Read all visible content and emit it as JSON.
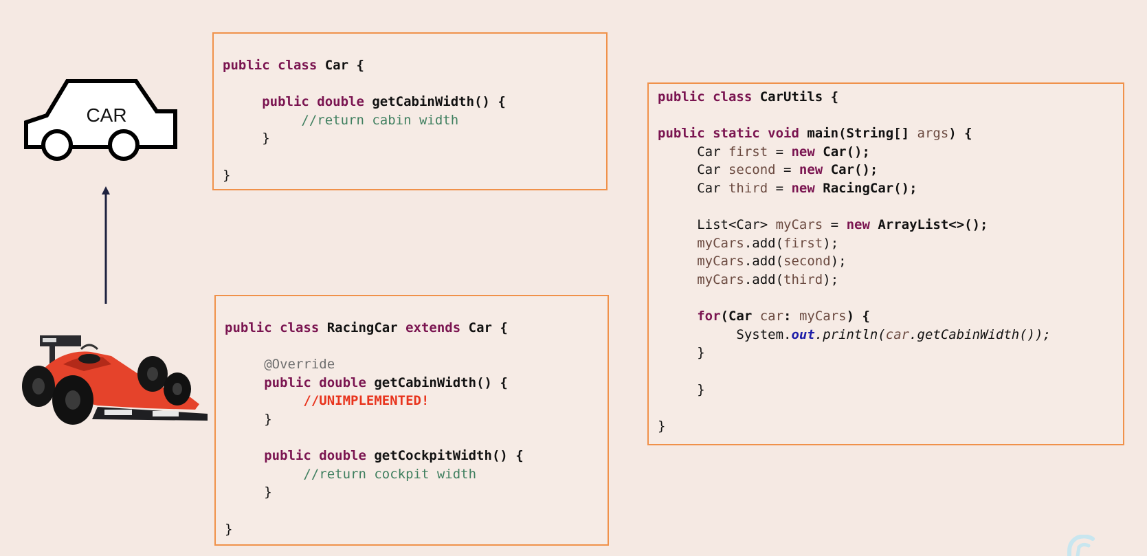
{
  "car_icon": {
    "label": "CAR"
  },
  "car_class": {
    "lines": [
      [
        {
          "t": "public class ",
          "s": "kw"
        },
        {
          "t": "Car {",
          "s": "b"
        }
      ],
      [],
      [
        {
          "t": "     public double ",
          "s": "kw"
        },
        {
          "t": "getCabinWidth",
          "s": "b"
        },
        {
          "t": "() {",
          "s": "b"
        }
      ],
      [
        {
          "t": "          //return cabin width",
          "s": "c"
        }
      ],
      [
        {
          "t": "     }",
          "s": "n"
        }
      ],
      [],
      [
        {
          "t": "}",
          "s": "n"
        }
      ]
    ]
  },
  "racing_class": {
    "lines": [
      [
        {
          "t": "public class ",
          "s": "kw"
        },
        {
          "t": "RacingCar ",
          "s": "b"
        },
        {
          "t": "extends ",
          "s": "kw"
        },
        {
          "t": "Car {",
          "s": "b"
        }
      ],
      [],
      [
        {
          "t": "     @Override",
          "s": "ann"
        }
      ],
      [
        {
          "t": "     public double ",
          "s": "kw"
        },
        {
          "t": "getCabinWidth",
          "s": "b"
        },
        {
          "t": "() {",
          "s": "b"
        }
      ],
      [
        {
          "t": "          //UNIMPLEMENTED!",
          "s": "red"
        }
      ],
      [
        {
          "t": "     }",
          "s": "n"
        }
      ],
      [],
      [
        {
          "t": "     public double ",
          "s": "kw"
        },
        {
          "t": "getCockpitWidth",
          "s": "b"
        },
        {
          "t": "() {",
          "s": "b"
        }
      ],
      [
        {
          "t": "          //return cockpit width",
          "s": "c"
        }
      ],
      [
        {
          "t": "     }",
          "s": "n"
        }
      ],
      [],
      [
        {
          "t": "}",
          "s": "n"
        }
      ]
    ]
  },
  "utils_class": {
    "lines": [
      [
        {
          "t": "public class ",
          "s": "kw"
        },
        {
          "t": "CarUtils {",
          "s": "b"
        }
      ],
      [],
      [
        {
          "t": "public static void ",
          "s": "kw"
        },
        {
          "t": "main(String[] ",
          "s": "b"
        },
        {
          "t": "args",
          "s": "v"
        },
        {
          "t": ") {",
          "s": "b"
        }
      ],
      [
        {
          "t": "     Car ",
          "s": "n"
        },
        {
          "t": "first",
          "s": "v"
        },
        {
          "t": " = ",
          "s": "n"
        },
        {
          "t": "new ",
          "s": "kw"
        },
        {
          "t": "Car();",
          "s": "b"
        }
      ],
      [
        {
          "t": "     Car ",
          "s": "n"
        },
        {
          "t": "second",
          "s": "v"
        },
        {
          "t": " = ",
          "s": "n"
        },
        {
          "t": "new ",
          "s": "kw"
        },
        {
          "t": "Car();",
          "s": "b"
        }
      ],
      [
        {
          "t": "     Car ",
          "s": "n"
        },
        {
          "t": "third",
          "s": "v"
        },
        {
          "t": " = ",
          "s": "n"
        },
        {
          "t": "new ",
          "s": "kw"
        },
        {
          "t": "RacingCar();",
          "s": "b"
        }
      ],
      [],
      [
        {
          "t": "     List<Car> ",
          "s": "n"
        },
        {
          "t": "myCars",
          "s": "v"
        },
        {
          "t": " = ",
          "s": "n"
        },
        {
          "t": "new ",
          "s": "kw"
        },
        {
          "t": "ArrayList<>();",
          "s": "b"
        }
      ],
      [
        {
          "t": "     myCars",
          "s": "v"
        },
        {
          "t": ".add(",
          "s": "n"
        },
        {
          "t": "first",
          "s": "v"
        },
        {
          "t": ");",
          "s": "n"
        }
      ],
      [
        {
          "t": "     myCars",
          "s": "v"
        },
        {
          "t": ".add(",
          "s": "n"
        },
        {
          "t": "second",
          "s": "v"
        },
        {
          "t": ");",
          "s": "n"
        }
      ],
      [
        {
          "t": "     myCars",
          "s": "v"
        },
        {
          "t": ".add(",
          "s": "n"
        },
        {
          "t": "third",
          "s": "v"
        },
        {
          "t": ");",
          "s": "n"
        }
      ],
      [],
      [
        {
          "t": "     for",
          "s": "kw"
        },
        {
          "t": "(Car ",
          "s": "b"
        },
        {
          "t": "car",
          "s": "v"
        },
        {
          "t": ": ",
          "s": "b"
        },
        {
          "t": "myCars",
          "s": "v"
        },
        {
          "t": ") {",
          "s": "b"
        }
      ],
      [
        {
          "t": "          System.",
          "s": "n"
        },
        {
          "t": "out",
          "s": "st"
        },
        {
          "t": ".println(",
          "s": "it"
        },
        {
          "t": "car",
          "s": "itv"
        },
        {
          "t": ".getCabinWidth());",
          "s": "it"
        }
      ],
      [
        {
          "t": "     }",
          "s": "n"
        }
      ],
      [],
      [
        {
          "t": "     }",
          "s": "n"
        }
      ],
      [],
      [
        {
          "t": "}",
          "s": "n"
        }
      ]
    ]
  },
  "colors": {
    "background": "#f5e9e3",
    "box_border": "#f0914a",
    "keyword": "#7a1450",
    "comment": "#3f7f5f",
    "warning": "#e8331c",
    "static_field": "#1c1ca8"
  }
}
